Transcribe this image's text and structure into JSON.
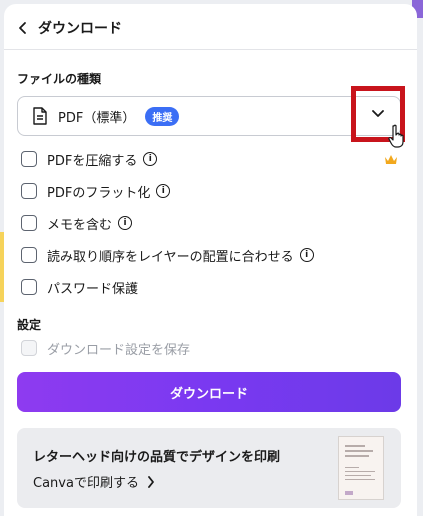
{
  "header": {
    "title": "ダウンロード"
  },
  "file_type": {
    "section_label": "ファイルの種類",
    "selected_value": "PDF（標準）",
    "badge": "推奨"
  },
  "options": [
    {
      "label": "PDFを圧縮する",
      "checked": false,
      "info": true,
      "premium": true
    },
    {
      "label": "PDFのフラット化",
      "checked": false,
      "info": true,
      "premium": false
    },
    {
      "label": "メモを含む",
      "checked": false,
      "info": true,
      "premium": false
    },
    {
      "label": "読み取り順序をレイヤーの配置に合わせる",
      "checked": false,
      "info": true,
      "premium": false
    },
    {
      "label": "パスワード保護",
      "checked": false,
      "info": false,
      "premium": false
    }
  ],
  "settings": {
    "section_label": "設定",
    "save_settings_label": "ダウンロード設定を保存",
    "save_settings_disabled": true
  },
  "download_button": {
    "label": "ダウンロード"
  },
  "promo": {
    "title": "レターヘッド向けの品質でデザインを印刷",
    "link_label": "Canvaで印刷する"
  },
  "colors": {
    "accent_gradient_start": "#8e3bf0",
    "accent_gradient_end": "#6c3ae8",
    "badge_blue": "#3b6ef5",
    "highlight_red": "#c8141c",
    "crown_gold": "#f2a81d"
  },
  "icons": {
    "back": "chevron-left-icon",
    "file": "document-icon",
    "dropdown": "chevron-down-icon",
    "info": "info-icon",
    "premium": "crown-icon",
    "promo_arrow": "chevron-right-icon",
    "cursor": "hand-cursor-icon"
  }
}
